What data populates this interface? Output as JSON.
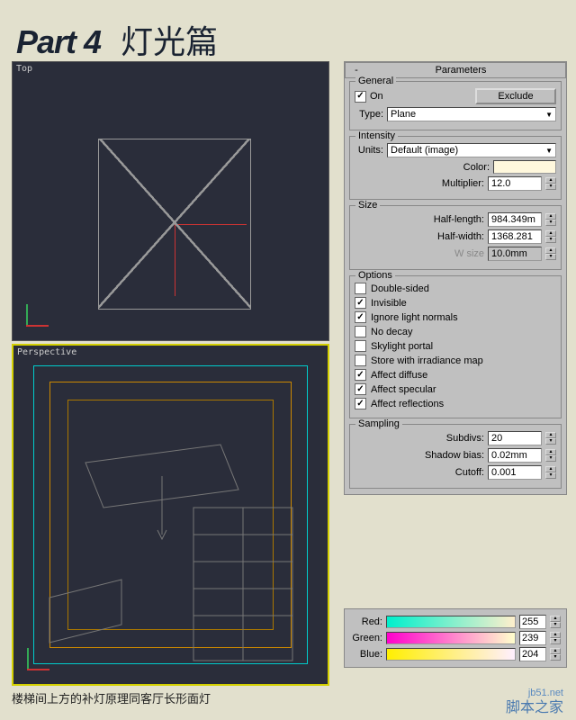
{
  "heading": {
    "part": "Part 4",
    "subtitle": "灯光篇"
  },
  "viewports": {
    "top": {
      "label": "Top"
    },
    "perspective": {
      "label": "Perspective"
    }
  },
  "caption": "楼梯间上方的补灯原理同客厅长形面灯",
  "panel": {
    "rollout_title": "Parameters",
    "rollout_toggle": "-",
    "general": {
      "legend": "General",
      "on_label": "On",
      "on_checked": true,
      "exclude_btn": "Exclude",
      "type_label": "Type:",
      "type_value": "Plane"
    },
    "intensity": {
      "legend": "Intensity",
      "units_label": "Units:",
      "units_value": "Default (image)",
      "color_label": "Color:",
      "color_value": "#fff8dd",
      "multiplier_label": "Multiplier:",
      "multiplier_value": "12.0"
    },
    "size": {
      "legend": "Size",
      "half_length_label": "Half-length:",
      "half_length_value": "984.349m",
      "half_width_label": "Half-width:",
      "half_width_value": "1368.281",
      "w_size_label": "W size",
      "w_size_value": "10.0mm"
    },
    "options": {
      "legend": "Options",
      "items": [
        {
          "label": "Double-sided",
          "checked": false
        },
        {
          "label": "Invisible",
          "checked": true
        },
        {
          "label": "Ignore light normals",
          "checked": true
        },
        {
          "label": "No decay",
          "checked": false
        },
        {
          "label": "Skylight portal",
          "checked": false
        },
        {
          "label": "Store with irradiance map",
          "checked": false
        },
        {
          "label": "Affect diffuse",
          "checked": true
        },
        {
          "label": "Affect specular",
          "checked": true
        },
        {
          "label": "Affect reflections",
          "checked": true
        }
      ]
    },
    "sampling": {
      "legend": "Sampling",
      "subdivs_label": "Subdivs:",
      "subdivs_value": "20",
      "shadow_bias_label": "Shadow bias:",
      "shadow_bias_value": "0.02mm",
      "cutoff_label": "Cutoff:",
      "cutoff_value": "0.001"
    }
  },
  "rgb": {
    "red_label": "Red:",
    "red_value": "255",
    "green_label": "Green:",
    "green_value": "239",
    "blue_label": "Blue:",
    "blue_value": "204"
  },
  "watermark": {
    "url": "jb51.net",
    "text": "脚本之家"
  }
}
